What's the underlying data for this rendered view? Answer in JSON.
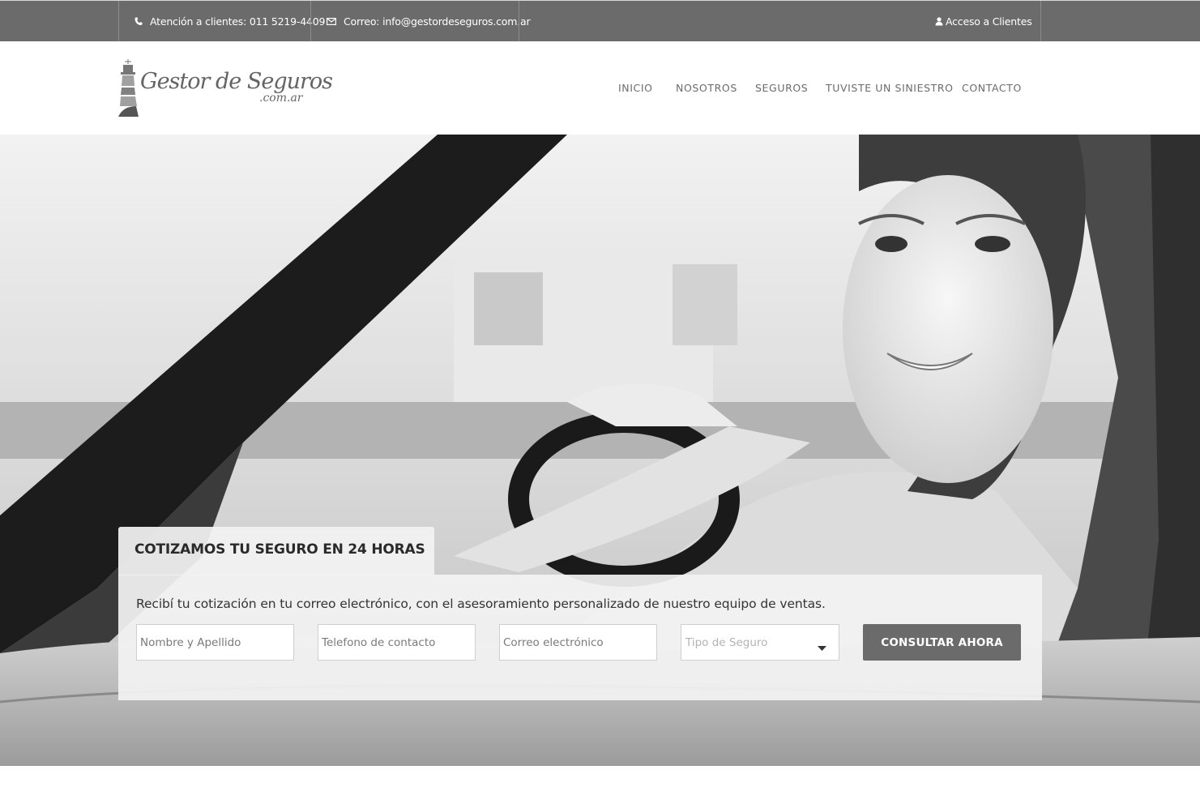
{
  "topbar": {
    "phone_text": "Atención a clientes: 011 5219-4409",
    "email_text": "Correo: info@gestordeseguros.com.ar",
    "client_access": "Acceso a Clientes"
  },
  "logo": {
    "brand": "Gestor de Seguros",
    "domain": ".com.ar"
  },
  "nav": {
    "items": [
      {
        "label": "INICIO"
      },
      {
        "label": "NOSOTROS"
      },
      {
        "label": "SEGUROS"
      },
      {
        "label": "TUVISTE UN SINIESTRO"
      },
      {
        "label": "CONTACTO"
      }
    ]
  },
  "quote_form": {
    "title": "COTIZAMOS TU SEGURO EN 24 HORAS",
    "description": "Recibí tu cotización en tu correo electrónico, con el asesoramiento personalizado de nuestro equipo de ventas.",
    "name_placeholder": "Nombre y Apellido",
    "phone_placeholder": "Telefono de contacto",
    "email_placeholder": "Correo electrónico",
    "insurance_type_placeholder": "Tipo de Seguro",
    "submit_label": "CONSULTAR AHORA"
  }
}
